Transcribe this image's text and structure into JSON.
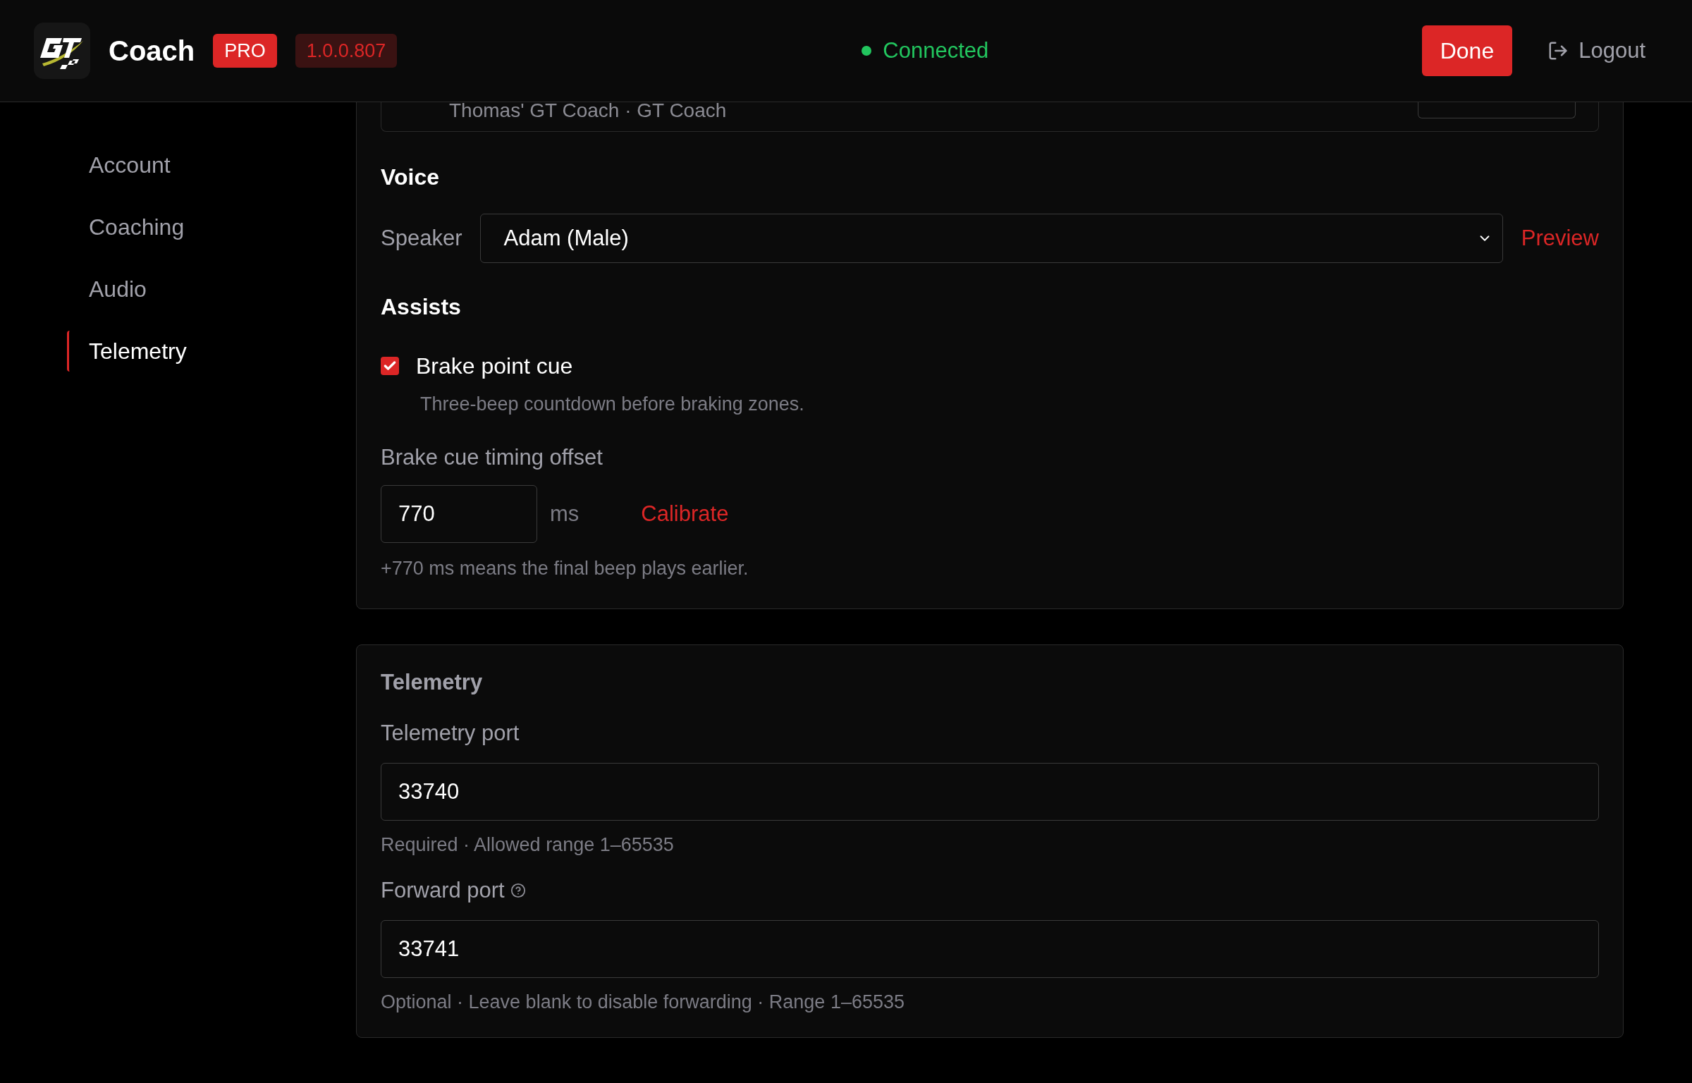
{
  "header": {
    "app_name": "Coach",
    "badge": "PRO",
    "version": "1.0.0.807",
    "status": {
      "text": "Connected",
      "connected": true
    },
    "done_button": "Done",
    "logout": "Logout"
  },
  "sidebar": {
    "items": [
      {
        "label": "Account",
        "selected": false
      },
      {
        "label": "Coaching",
        "selected": false
      },
      {
        "label": "Audio",
        "selected": false
      },
      {
        "label": "Telemetry",
        "selected": true
      }
    ]
  },
  "device_card": {
    "subtitle": "Thomas' GT Coach · GT Coach"
  },
  "voice": {
    "title": "Voice",
    "speaker_label": "Speaker",
    "speaker_value": "Adam (Male)",
    "preview": "Preview"
  },
  "assists": {
    "title": "Assists",
    "brake_point_cue": {
      "label": "Brake point cue",
      "checked": true,
      "help": "Three-beep countdown before braking zones."
    },
    "offset": {
      "label": "Brake cue timing offset",
      "value": "770",
      "unit": "ms",
      "calibrate": "Calibrate",
      "help": "+770 ms means the final beep plays earlier."
    }
  },
  "telemetry": {
    "title": "Telemetry",
    "fields": [
      {
        "label": "Telemetry port",
        "value": "33740",
        "help": "Required · Allowed range 1–65535",
        "info": false
      },
      {
        "label": "Forward port",
        "value": "33741",
        "help": "Optional · Leave blank to disable forwarding · Range 1–65535",
        "info": true
      }
    ]
  }
}
